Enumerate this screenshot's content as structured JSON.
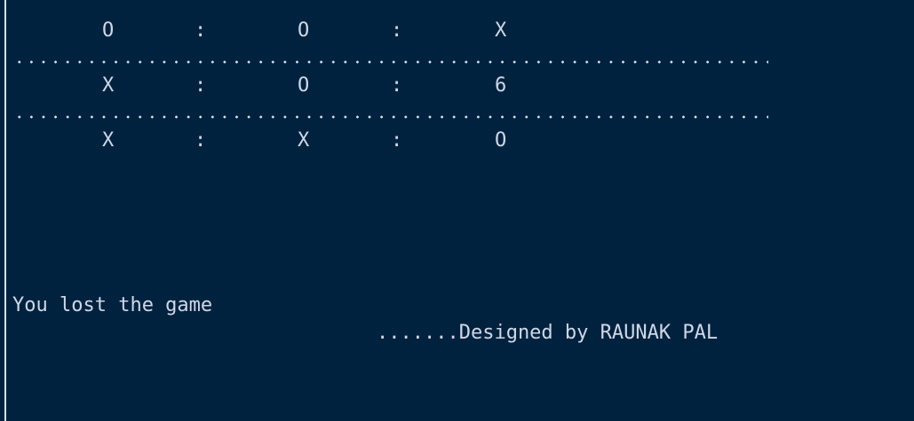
{
  "board": {
    "rows": [
      [
        "O",
        "O",
        "X"
      ],
      [
        "X",
        "O",
        "6"
      ],
      [
        "X",
        "X",
        "O"
      ]
    ],
    "separator": ":"
  },
  "message": {
    "result": "You lost the game",
    "credit": ".......Designed by RAUNAK PAL"
  },
  "colors": {
    "background": "#00223f",
    "text": "#cfd8e6",
    "border": "#d9e2ee"
  }
}
